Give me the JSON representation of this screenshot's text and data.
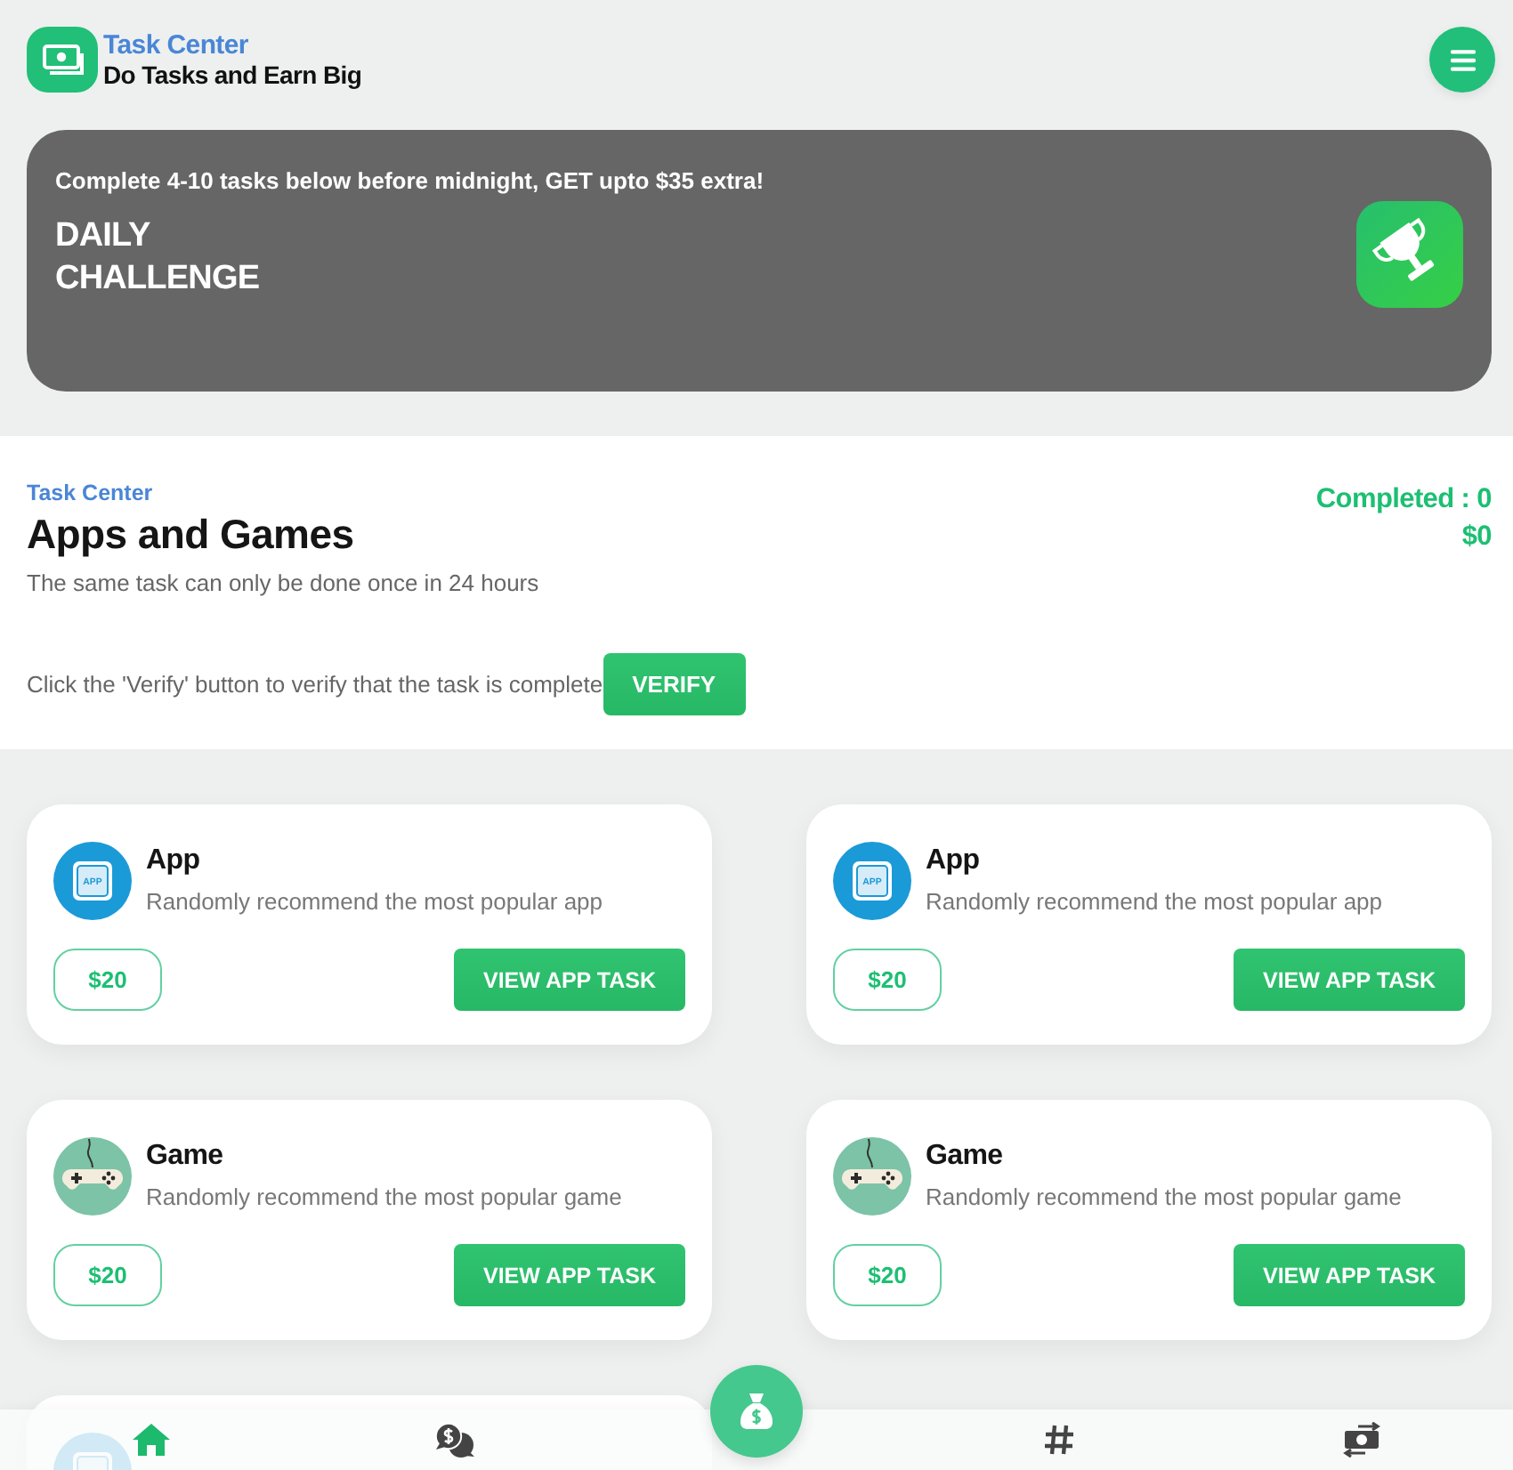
{
  "header": {
    "title": "Task Center",
    "subtitle": "Do Tasks and Earn Big"
  },
  "banner": {
    "note": "Complete 4-10 tasks below before midnight, GET upto $35 extra!",
    "heading": "DAILY CHALLENGE"
  },
  "section": {
    "eyebrow": "Task Center",
    "title": "Apps and Games",
    "note": "The same task can only be done once in 24 hours",
    "completed": "Completed : 0",
    "earned": "$0",
    "verify_hint": "Click the 'Verify' button to verify that the task is complete",
    "verify_button": "VERIFY"
  },
  "tasks": [
    {
      "kind": "app",
      "icon_text": "APP",
      "title": "App",
      "description": "Randomly recommend the most popular app",
      "reward": "$20",
      "button": "VIEW APP TASK"
    },
    {
      "kind": "app",
      "icon_text": "APP",
      "title": "App",
      "description": "Randomly recommend the most popular app",
      "reward": "$20",
      "button": "VIEW APP TASK"
    },
    {
      "kind": "game",
      "title": "Game",
      "description": "Randomly recommend the most popular game",
      "reward": "$20",
      "button": "VIEW APP TASK"
    },
    {
      "kind": "game",
      "title": "Game",
      "description": "Randomly recommend the most popular game",
      "reward": "$20",
      "button": "VIEW APP TASK"
    },
    {
      "kind": "app"
    }
  ],
  "bottom_nav": {
    "items": [
      {
        "kind": "home",
        "selected": true
      },
      {
        "kind": "chat",
        "selected": false
      },
      {
        "kind": "bag",
        "selected": false
      },
      {
        "kind": "hash",
        "selected": false
      },
      {
        "kind": "exchange",
        "selected": false
      }
    ]
  }
}
